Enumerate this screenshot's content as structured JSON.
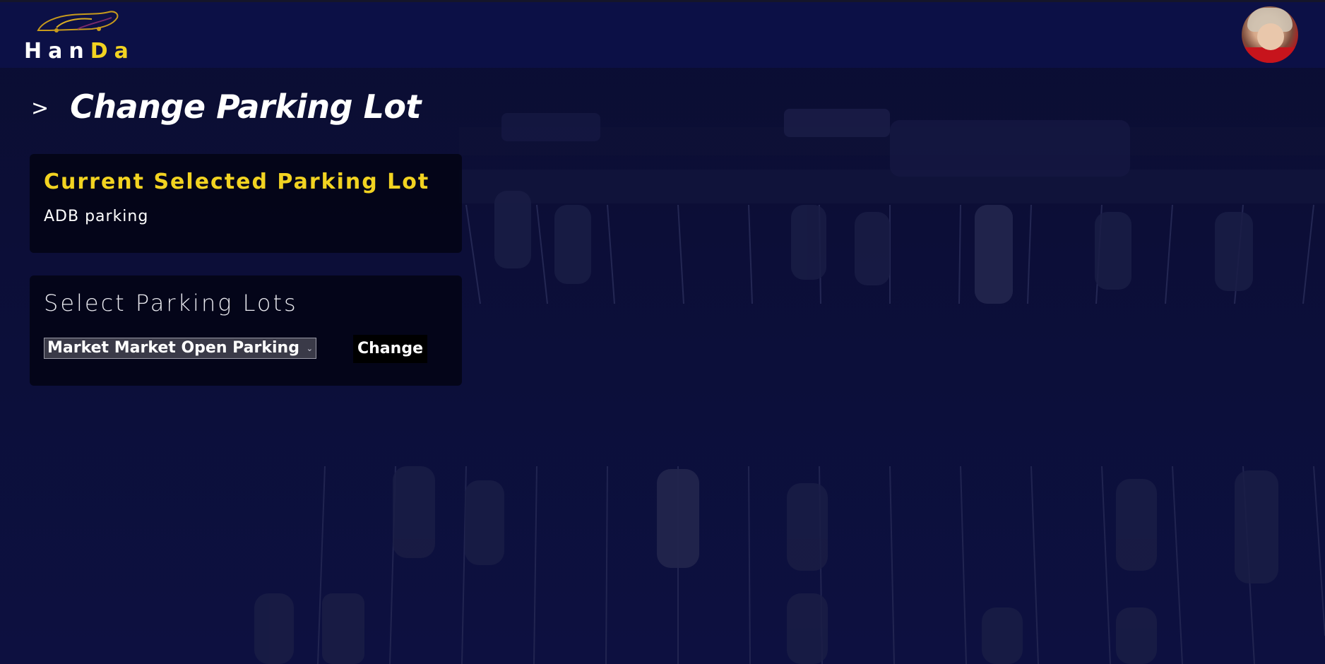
{
  "app": {
    "logo_text_first": "Han",
    "logo_text_second": "Da",
    "accent_color": "#f2d321"
  },
  "header": {
    "avatar_alt": "user avatar"
  },
  "page": {
    "title": "Change Parking Lot",
    "arrow": ">"
  },
  "current_card": {
    "title": "Current Selected Parking Lot",
    "value": "ADB parking"
  },
  "select_card": {
    "title": "Select Parking Lots",
    "selected_option": "Market Market Open Parking",
    "change_label": "Change"
  },
  "icons": {
    "logo": "car-logo-icon",
    "chevron": "chevron-down-icon",
    "heading_arrow": "chevron-right-icon"
  }
}
